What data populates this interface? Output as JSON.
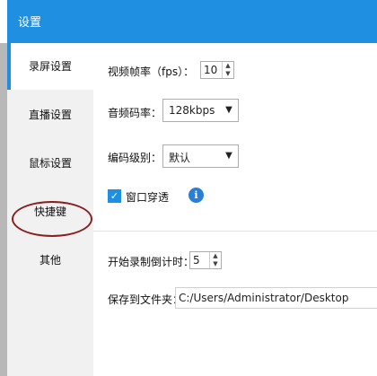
{
  "window": {
    "title": "设置"
  },
  "sidebar": {
    "items": [
      {
        "label": "录屏设置",
        "active": true
      },
      {
        "label": "直播设置",
        "active": false
      },
      {
        "label": "鼠标设置",
        "active": false
      },
      {
        "label": "快捷键",
        "active": false
      },
      {
        "label": "其他",
        "active": false
      }
    ]
  },
  "settings": {
    "fps": {
      "label": "视频帧率（fps）：",
      "value": "10"
    },
    "bitrate": {
      "label": "音频码率：",
      "value": "128kbps"
    },
    "encode_level": {
      "label": "编码级别：",
      "value": "默认"
    },
    "window_passthrough": {
      "label": "窗口穿透",
      "checked": true
    },
    "countdown": {
      "label": "开始录制倒计时：",
      "value": "5"
    },
    "save_path": {
      "label": "保存到文件夹：",
      "value": "C:/Users/Administrator/Desktop"
    }
  },
  "colors": {
    "accent": "#1e8fe1",
    "annotation": "#8b1e1e"
  }
}
